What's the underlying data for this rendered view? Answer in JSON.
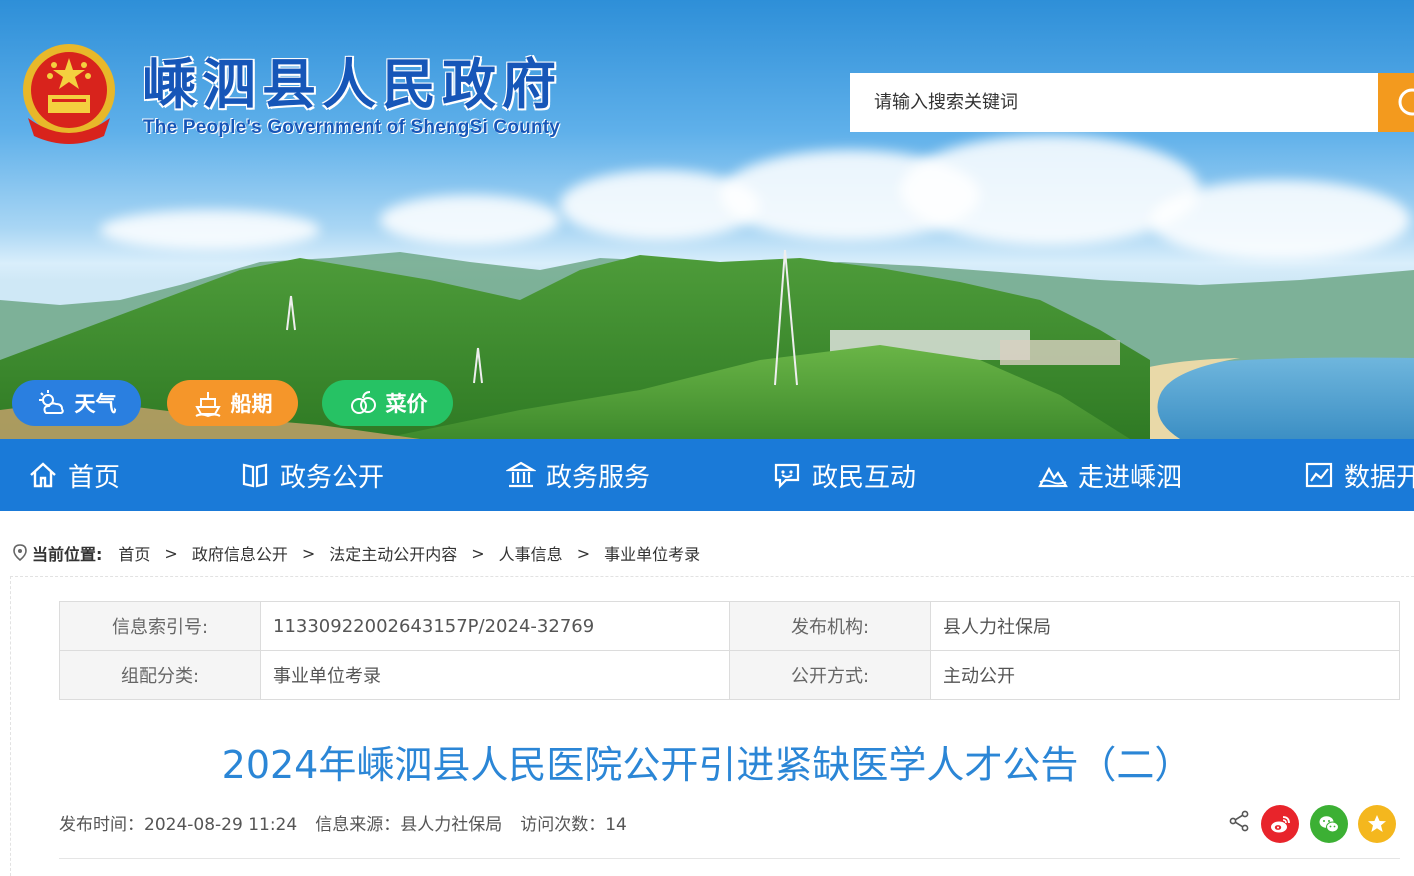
{
  "site": {
    "title": "嵊泗县人民政府",
    "subtitle": "The People's Government of ShengSi County"
  },
  "search": {
    "placeholder": "请输入搜索关键词",
    "button_color": "#f39a1e"
  },
  "quick_links": [
    {
      "label": "天气",
      "icon": "weather-icon",
      "color": "#2a7fe0"
    },
    {
      "label": "船期",
      "icon": "ship-icon",
      "color": "#f5962a"
    },
    {
      "label": "菜价",
      "icon": "vegetable-icon",
      "color": "#26c264"
    }
  ],
  "nav": {
    "background": "#1a7ad8",
    "items": [
      {
        "label": "首页",
        "icon": "home-icon"
      },
      {
        "label": "政务公开",
        "icon": "book-icon"
      },
      {
        "label": "政务服务",
        "icon": "building-icon"
      },
      {
        "label": "政民互动",
        "icon": "chat-icon"
      },
      {
        "label": "走进嵊泗",
        "icon": "mountain-icon"
      },
      {
        "label": "数据开",
        "icon": "chart-icon"
      }
    ]
  },
  "breadcrumb": {
    "label": "当前位置:",
    "items": [
      "首页",
      "政府信息公开",
      "法定主动公开内容",
      "人事信息",
      "事业单位考录"
    ],
    "separator": ">"
  },
  "meta": {
    "index_label": "信息索引号:",
    "index_value": "11330922002643157P/2024-32769",
    "publisher_label": "发布机构:",
    "publisher_value": "县人力社保局",
    "category_label": "组配分类:",
    "category_value": "事业单位考录",
    "method_label": "公开方式:",
    "method_value": "主动公开"
  },
  "article": {
    "title": "2024年嵊泗县人民医院公开引进紧缺医学人才公告（二）",
    "publish_time": "发布时间：2024-08-29 11:24",
    "source": "信息来源：县人力社保局",
    "visits": "访问次数：14",
    "title_color": "#2b86d6"
  },
  "share": {
    "icons": [
      "share-icon",
      "weibo-icon",
      "wechat-icon",
      "favorite-icon"
    ]
  }
}
